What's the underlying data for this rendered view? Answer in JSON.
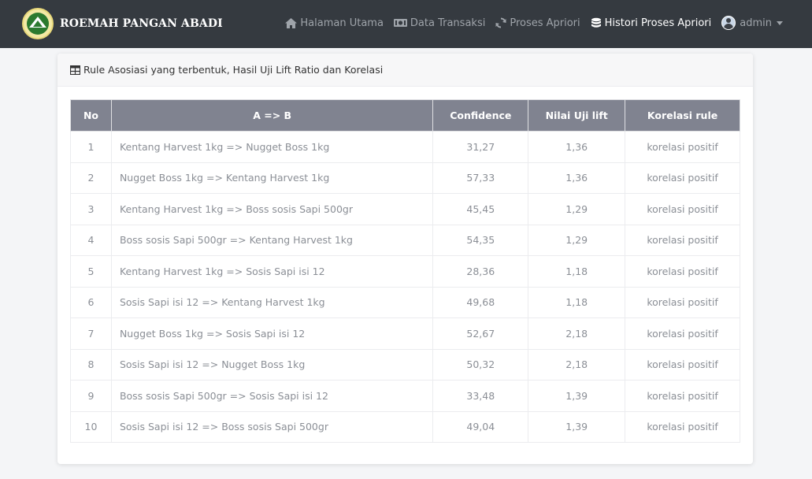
{
  "brand": {
    "name": "ROEMAH PANGAN ABADI"
  },
  "nav": {
    "items": [
      {
        "label": "Halaman Utama",
        "icon": "home-icon"
      },
      {
        "label": "Data Transaksi",
        "icon": "money-icon"
      },
      {
        "label": "Proses Apriori",
        "icon": "sync-icon"
      },
      {
        "label": "Histori Proses Apriori",
        "icon": "database-icon"
      }
    ],
    "user": "admin"
  },
  "card": {
    "title": "Rule Asosiasi yang terbentuk, Hasil Uji Lift Ratio dan Korelasi"
  },
  "table": {
    "headers": [
      "No",
      "A => B",
      "Confidence",
      "Nilai Uji lift",
      "Korelasi rule"
    ],
    "rows": [
      {
        "no": "1",
        "rule": "Kentang Harvest 1kg => Nugget Boss 1kg",
        "confidence": "31,27",
        "lift": "1,36",
        "korelasi": "korelasi positif"
      },
      {
        "no": "2",
        "rule": "Nugget Boss 1kg => Kentang Harvest 1kg",
        "confidence": "57,33",
        "lift": "1,36",
        "korelasi": "korelasi positif"
      },
      {
        "no": "3",
        "rule": "Kentang Harvest 1kg => Boss sosis Sapi 500gr",
        "confidence": "45,45",
        "lift": "1,29",
        "korelasi": "korelasi positif"
      },
      {
        "no": "4",
        "rule": "Boss sosis Sapi 500gr => Kentang Harvest 1kg",
        "confidence": "54,35",
        "lift": "1,29",
        "korelasi": "korelasi positif"
      },
      {
        "no": "5",
        "rule": "Kentang Harvest 1kg => Sosis Sapi isi 12",
        "confidence": "28,36",
        "lift": "1,18",
        "korelasi": "korelasi positif"
      },
      {
        "no": "6",
        "rule": "Sosis Sapi isi 12 => Kentang Harvest 1kg",
        "confidence": "49,68",
        "lift": "1,18",
        "korelasi": "korelasi positif"
      },
      {
        "no": "7",
        "rule": "Nugget Boss 1kg => Sosis Sapi isi 12",
        "confidence": "52,67",
        "lift": "2,18",
        "korelasi": "korelasi positif"
      },
      {
        "no": "8",
        "rule": "Sosis Sapi isi 12 => Nugget Boss 1kg",
        "confidence": "50,32",
        "lift": "2,18",
        "korelasi": "korelasi positif"
      },
      {
        "no": "9",
        "rule": "Boss sosis Sapi 500gr => Sosis Sapi isi 12",
        "confidence": "33,48",
        "lift": "1,39",
        "korelasi": "korelasi positif"
      },
      {
        "no": "10",
        "rule": "Sosis Sapi isi 12 => Boss sosis Sapi 500gr",
        "confidence": "49,04",
        "lift": "1,39",
        "korelasi": "korelasi positif"
      }
    ]
  },
  "colors": {
    "navbar": "#353a40",
    "table_header": "#808390",
    "logo_green": "#2c7a2f"
  }
}
